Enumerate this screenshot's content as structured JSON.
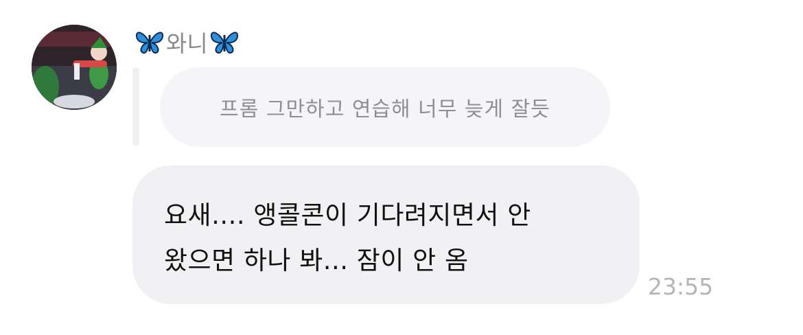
{
  "sender": {
    "emoji_left": "butterfly-icon",
    "name": "와니",
    "emoji_right": "butterfly-icon"
  },
  "reply": {
    "text": "프롬 그만하고 연습해 너무 늦게 잘듯"
  },
  "message": {
    "lines": [
      "요새.... 앵콜콘이 기다려지면서 안",
      "왔으면 하나 봐... 잠이 안 옴"
    ]
  },
  "timestamp": "23:55",
  "colors": {
    "bubble": "#f1f1f4",
    "reply_text": "#8e8e93",
    "timestamp": "#b5b5b9",
    "butterfly": "#2f8fd8"
  }
}
